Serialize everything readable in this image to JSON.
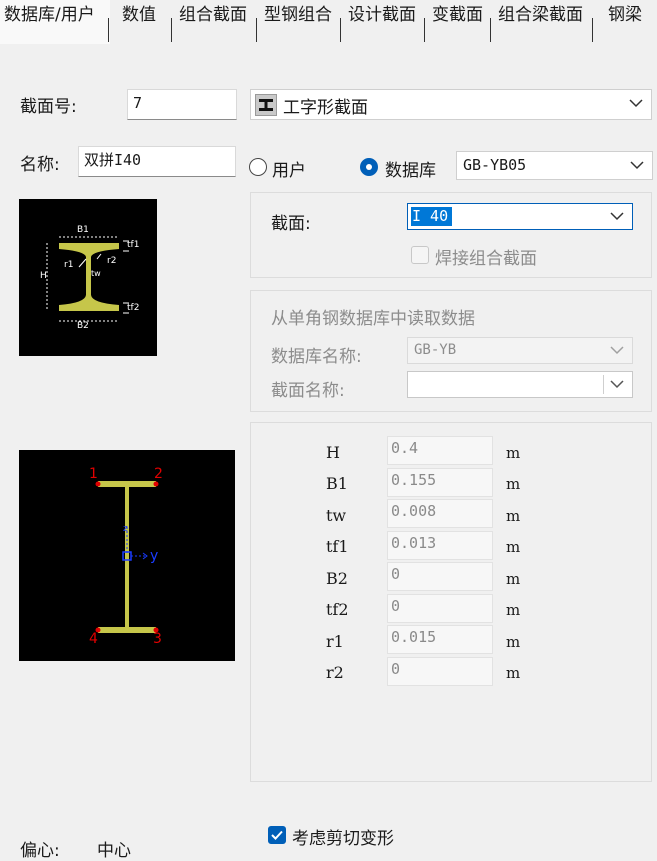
{
  "tabs": [
    "数据库/用户",
    "数值",
    "组合截面",
    "型钢组合",
    "设计截面",
    "变截面",
    "组合梁截面",
    "钢梁"
  ],
  "section_no": {
    "label": "截面号:",
    "value": "7"
  },
  "shape_combo": {
    "value": "工字形截面"
  },
  "name": {
    "label": "名称:",
    "value": "双拼I40"
  },
  "source": {
    "user_label": "用户",
    "db_label": "数据库",
    "db_value": "GB-YB05"
  },
  "section_group": {
    "label": "截面:",
    "value": "I 40",
    "welded_label": "焊接组合截面"
  },
  "angle_group": {
    "title": "从单角钢数据库中读取数据",
    "db_name_label": "数据库名称:",
    "db_name_value": "GB-YB",
    "section_name_label": "截面名称:",
    "section_name_value": ""
  },
  "schematic": {
    "B1": "B1",
    "B2": "B2",
    "H": "H",
    "tf1": "tf1",
    "tf2": "tf2",
    "tw": "tw",
    "r1": "r1",
    "r2": "r2"
  },
  "preview": {
    "points": [
      "1",
      "2",
      "3",
      "4"
    ],
    "axis_y": "y",
    "axis_z": "z"
  },
  "params": [
    {
      "name": "H",
      "value": "0.4",
      "unit": "m"
    },
    {
      "name": "B1",
      "value": "0.155",
      "unit": "m"
    },
    {
      "name": "tw",
      "value": "0.008",
      "unit": "m"
    },
    {
      "name": "tf1",
      "value": "0.013",
      "unit": "m"
    },
    {
      "name": "B2",
      "value": "0",
      "unit": "m"
    },
    {
      "name": "tf2",
      "value": "0",
      "unit": "m"
    },
    {
      "name": "r1",
      "value": "0.015",
      "unit": "m"
    },
    {
      "name": "r2",
      "value": "0",
      "unit": "m"
    }
  ],
  "shear": {
    "label": "考虑剪切变形"
  },
  "offset": {
    "label": "偏心:",
    "value": "中心"
  },
  "colors": {
    "accent": "#005fb8",
    "flange": "#c6c64a",
    "point": "#e00000",
    "axis": "#1a3cff"
  }
}
